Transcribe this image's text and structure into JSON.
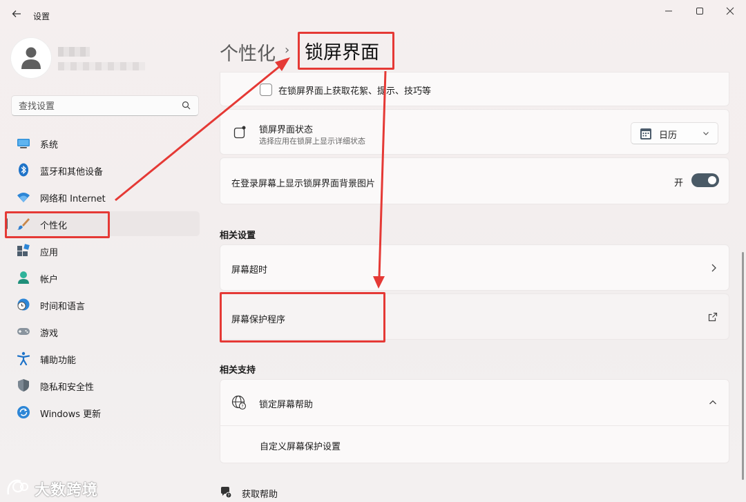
{
  "window": {
    "title": "设置"
  },
  "search": {
    "placeholder": "查找设置"
  },
  "sidebar": {
    "items": [
      {
        "label": "系统",
        "icon": "monitor-icon"
      },
      {
        "label": "蓝牙和其他设备",
        "icon": "bluetooth-icon"
      },
      {
        "label": "网络和 Internet",
        "icon": "wifi-icon"
      },
      {
        "label": "个性化",
        "icon": "paintbrush-icon",
        "active": true
      },
      {
        "label": "应用",
        "icon": "apps-icon"
      },
      {
        "label": "帐户",
        "icon": "account-icon"
      },
      {
        "label": "时间和语言",
        "icon": "clock-globe-icon"
      },
      {
        "label": "游戏",
        "icon": "gamepad-icon"
      },
      {
        "label": "辅助功能",
        "icon": "accessibility-icon"
      },
      {
        "label": "隐私和安全性",
        "icon": "shield-icon"
      },
      {
        "label": "Windows 更新",
        "icon": "update-icon"
      }
    ]
  },
  "header": {
    "parent": "个性化",
    "separator": "›",
    "title": "锁屏界面"
  },
  "lockscreen": {
    "tips_checkbox": {
      "label": "在锁屏界面上获取花絮、提示、技巧等",
      "checked": false
    },
    "status": {
      "title": "锁屏界面状态",
      "subtitle": "选择应用在锁屏上显示详细状态",
      "selected": "日历"
    },
    "signin_bg": {
      "label": "在登录屏幕上显示锁屏界面背景图片",
      "state_label": "开",
      "on": true
    }
  },
  "related_settings": {
    "heading": "相关设置",
    "timeout": "屏幕超时",
    "screensaver": "屏幕保护程序"
  },
  "related_support": {
    "heading": "相关支持",
    "help_title": "锁定屏幕帮助",
    "help_link": "自定义屏幕保护设置"
  },
  "footer": {
    "get_help": "获取帮助"
  },
  "watermark": {
    "text": "大数跨境"
  },
  "colors": {
    "annotation": "#e53935",
    "toggle_on": "#4a5a66"
  }
}
